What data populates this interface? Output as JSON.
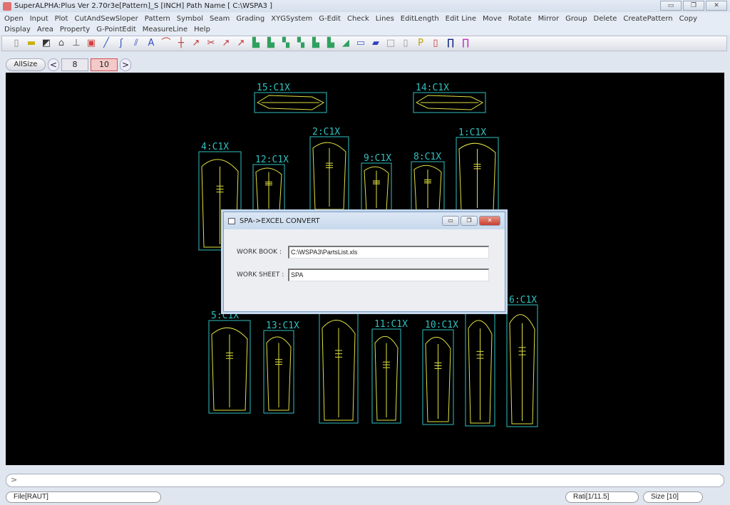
{
  "window": {
    "title": "SuperALPHA:Plus Ver 2.70r3e[Pattern]_S [INCH]  Path Name   [ C:\\WSPA3 ]",
    "controls": [
      "▭",
      "❐",
      "✕"
    ]
  },
  "menu": [
    "Open",
    "Input",
    "Plot",
    "CutAndSewSloper",
    "Pattern",
    "Symbol",
    "Seam",
    "Grading",
    "XYGSystem",
    "G-Edit",
    "Check",
    "Lines",
    "EditLength",
    "Edit Line",
    "Move",
    "Rotate",
    "Mirror",
    "Group",
    "Delete",
    "CreatePattern",
    "Copy",
    "Display",
    "Area",
    "Property",
    "G-PointEdit",
    "MeasureLine",
    "Help"
  ],
  "toolbar": [
    {
      "name": "new-icon",
      "glyph": "▯",
      "color": "#888"
    },
    {
      "name": "open-folder-icon",
      "glyph": "▬",
      "color": "#c8b000"
    },
    {
      "name": "save-disk-icon",
      "glyph": "◩",
      "color": "#333"
    },
    {
      "name": "plotter-icon",
      "glyph": "⌂",
      "color": "#555"
    },
    {
      "name": "digitizer-icon",
      "glyph": "⊥",
      "color": "#555"
    },
    {
      "name": "page-icon",
      "glyph": "▣",
      "color": "#d04040"
    },
    {
      "name": "line-icon",
      "glyph": "╱",
      "color": "#3050c0"
    },
    {
      "name": "curve-icon",
      "glyph": "ʃ",
      "color": "#3050c0"
    },
    {
      "name": "parallel-line-icon",
      "glyph": "⫽",
      "color": "#3050c0"
    },
    {
      "name": "text-icon",
      "glyph": "A",
      "color": "#3050c0"
    },
    {
      "name": "arc-icon",
      "glyph": "⌒",
      "color": "#c03030"
    },
    {
      "name": "cross-icon",
      "glyph": "┼",
      "color": "#c03030"
    },
    {
      "name": "corner-icon",
      "glyph": "↗",
      "color": "#c03030"
    },
    {
      "name": "scissors-icon",
      "glyph": "✂",
      "color": "#c03030"
    },
    {
      "name": "arrow-icon",
      "glyph": "↗",
      "color": "#c03030"
    },
    {
      "name": "arrow-2-icon",
      "glyph": "↗",
      "color": "#c03030"
    },
    {
      "name": "piece-icon",
      "glyph": "▙",
      "color": "#30a060"
    },
    {
      "name": "piece-2-icon",
      "glyph": "▙",
      "color": "#30a060"
    },
    {
      "name": "piece-3-icon",
      "glyph": "▚",
      "color": "#30a060"
    },
    {
      "name": "piece-4-icon",
      "glyph": "▚",
      "color": "#30a060"
    },
    {
      "name": "piece-5-icon",
      "glyph": "▙",
      "color": "#30a060"
    },
    {
      "name": "piece-6-icon",
      "glyph": "▙",
      "color": "#30a060"
    },
    {
      "name": "eraser-icon",
      "glyph": "◢",
      "color": "#30a060"
    },
    {
      "name": "window-icon",
      "glyph": "▭",
      "color": "#4060d0"
    },
    {
      "name": "layers-icon",
      "glyph": "▰",
      "color": "#3040c0"
    },
    {
      "name": "blank-icon",
      "glyph": "□",
      "color": "#999"
    },
    {
      "name": "book-icon",
      "glyph": "▯",
      "color": "#999"
    },
    {
      "name": "pac-icon",
      "glyph": "P",
      "color": "#c0a000"
    },
    {
      "name": "file-red-icon",
      "glyph": "▯",
      "color": "#d03030"
    },
    {
      "name": "pattern-outline-icon",
      "glyph": "∏",
      "color": "#102080"
    },
    {
      "name": "pattern-color-icon",
      "glyph": "∏",
      "color": "#c030c0"
    }
  ],
  "sizes": {
    "allsize": "AllSize",
    "prev": "<",
    "next": ">",
    "items": [
      "8",
      "10"
    ],
    "selected": "10"
  },
  "pieces": [
    "15:C1X",
    "14:C1X",
    "4:C1X",
    "12:C1X",
    "2:C1X",
    "9:C1X",
    "8:C1X",
    "1:C1X",
    "5:C1X",
    "13:C1X",
    "",
    "11:C1X",
    "10:C1X",
    "",
    "6:C1X"
  ],
  "colors": {
    "piece_box": "#30c0c0",
    "piece_line": "#e0e040",
    "canvas": "#000000"
  },
  "dialog": {
    "title": "SPA->EXCEL CONVERT",
    "workbook_label": "WORK BOOK :",
    "workbook_value": "C:\\WSPA3\\PartsList.xls",
    "worksheet_label": "WORK SHEET :",
    "worksheet_value": "SPA"
  },
  "command": {
    "prompt": ">"
  },
  "status": {
    "file": "File[RAUT]",
    "ratio": "Rati[1/11.5]",
    "size": "Size [10]"
  }
}
